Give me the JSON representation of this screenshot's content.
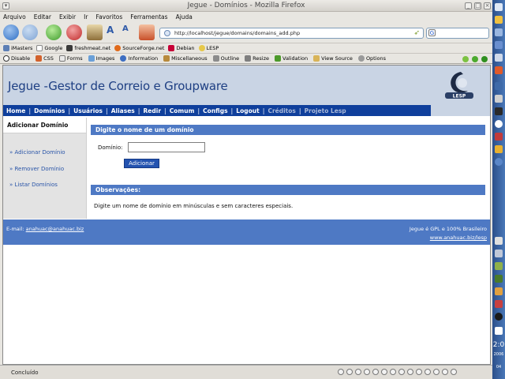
{
  "window": {
    "title": "Jegue - Domínios - Mozilla Firefox"
  },
  "menubar": [
    "Arquivo",
    "Editar",
    "Exibir",
    "Ir",
    "Favoritos",
    "Ferramentas",
    "Ajuda"
  ],
  "navigation": {
    "url": "http://localhost/jegue/domains/domains_add.php"
  },
  "bookmarks": [
    "iMasters",
    "Google",
    "freshmeat.net",
    "SourceForge.net",
    "Debian",
    "LESP"
  ],
  "devtoolbar": [
    "Disable",
    "CSS",
    "Forms",
    "Images",
    "Information",
    "Miscellaneous",
    "Outline",
    "Resize",
    "Validation",
    "View Source",
    "Options"
  ],
  "site": {
    "title": "Jegue -Gestor de Correio e Groupware",
    "logo_text": "LESP",
    "nav": [
      "Home",
      "Domínios",
      "Usuários",
      "Aliases",
      "Redir",
      "Comum",
      "Configs",
      "Logout",
      "Créditos",
      "Projeto Lesp"
    ],
    "sidebar": {
      "heading": "Adicionar Domínio",
      "links": [
        "» Adicionar Domínio",
        "» Remover Domínio",
        "» Listar Domínios"
      ]
    },
    "form": {
      "bar_title": "Digite o nome de um domínio",
      "field_label": "Domínio:",
      "field_value": "",
      "submit_label": "Adicionar"
    },
    "notes": {
      "bar_title": "Observações:",
      "text": "Digite um nome de domínio em minúsculas e sem caracteres especiais."
    },
    "footer": {
      "email_label": "E-mail:",
      "email": "anahuac@anahuac.biz",
      "right_line1": "Jegue é GPL e 100% Brasileiro",
      "right_link": "www.anahuac.biz/lesp"
    }
  },
  "statusbar": {
    "text": "Concluído"
  },
  "dock": {
    "clock": "2:0",
    "year": "2006",
    "extra": "04"
  },
  "colors": {
    "nav_blue": "#0f3f9c",
    "bar_blue": "#4e79c4",
    "header_bg": "#c9d4e4"
  }
}
